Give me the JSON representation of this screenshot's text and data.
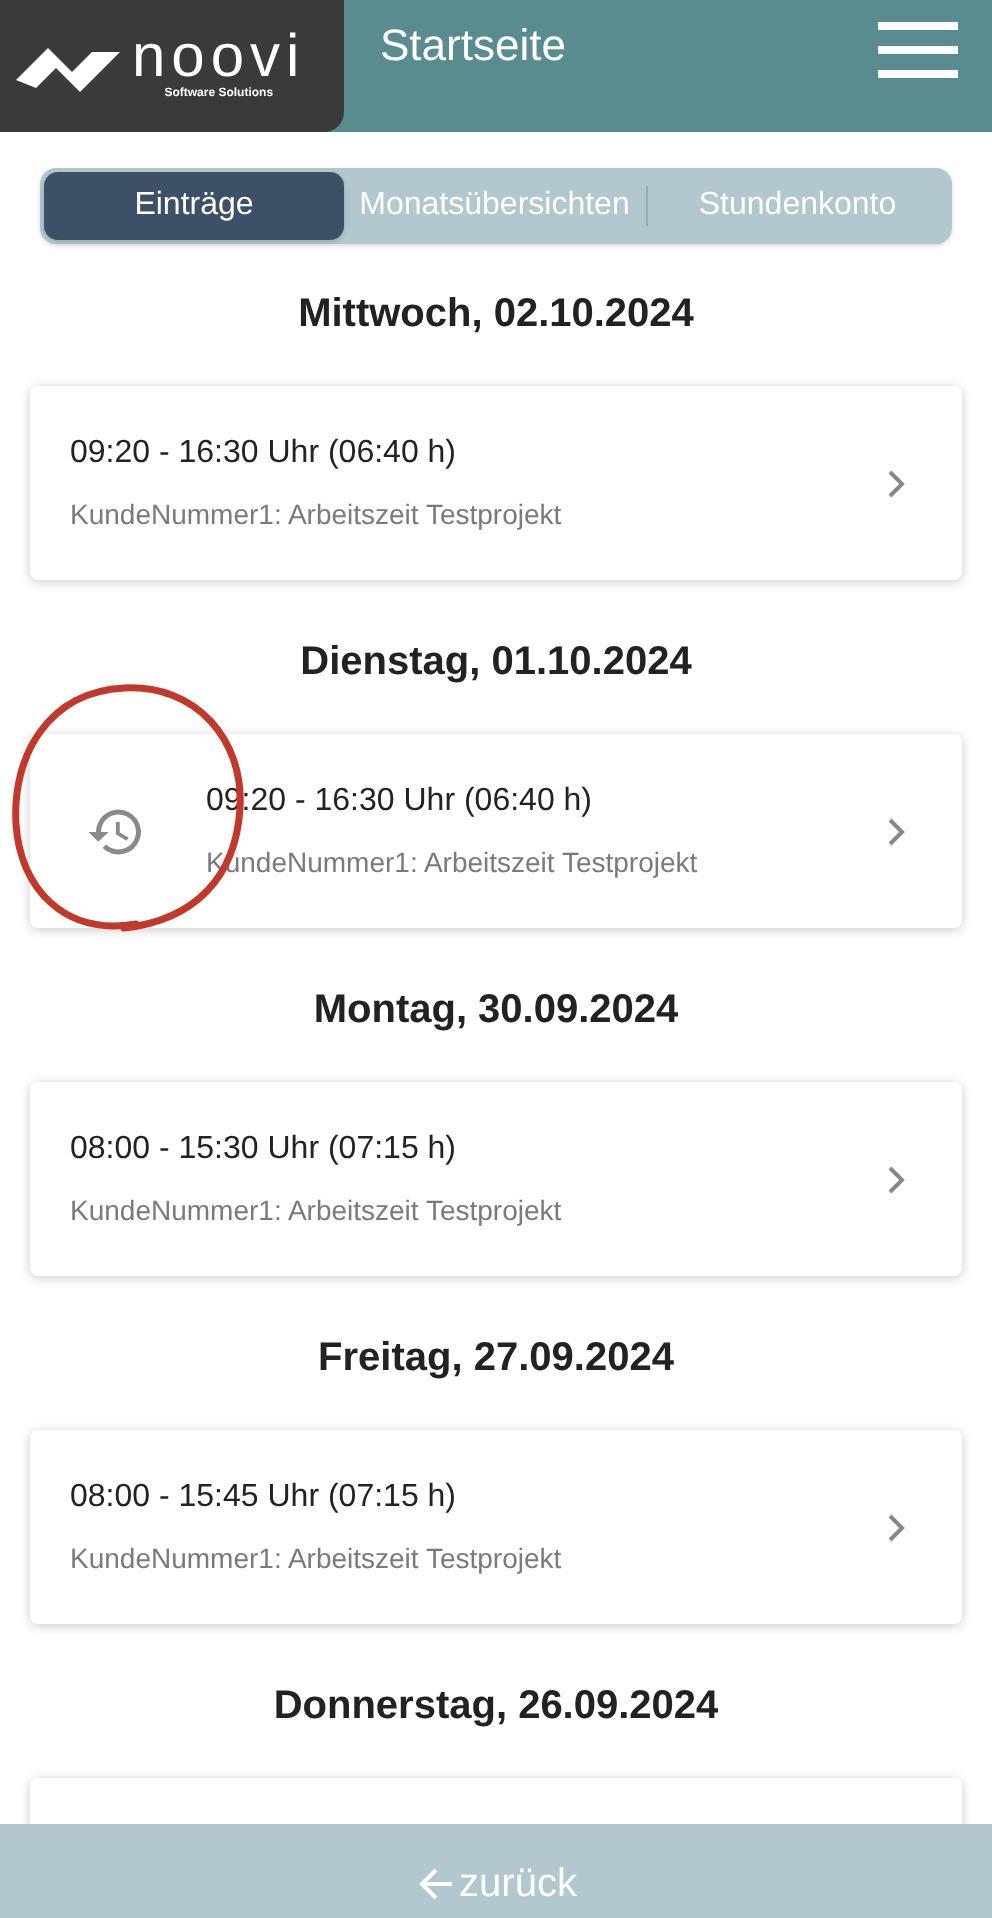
{
  "header": {
    "logo": {
      "name": "noovi",
      "tagline": "Software Solutions"
    },
    "title": "Startseite"
  },
  "tabs": [
    {
      "label": "Einträge",
      "selected": true
    },
    {
      "label": "Monatsübersichten",
      "selected": false
    },
    {
      "label": "Stundenkonto",
      "selected": false
    }
  ],
  "days": [
    {
      "date": "Mittwoch, 02.10.2024",
      "entries": [
        {
          "time": "09:20 - 16:30 Uhr (06:40 h)",
          "project": "KundeNummer1: Arbeitszeit Testprojekt",
          "history": false
        }
      ]
    },
    {
      "date": "Dienstag, 01.10.2024",
      "entries": [
        {
          "time": "09:20 - 16:30 Uhr (06:40 h)",
          "project": "KundeNummer1: Arbeitszeit Testprojekt",
          "history": true
        }
      ]
    },
    {
      "date": "Montag, 30.09.2024",
      "entries": [
        {
          "time": "08:00 - 15:30 Uhr (07:15 h)",
          "project": "KundeNummer1: Arbeitszeit Testprojekt",
          "history": false
        }
      ]
    },
    {
      "date": "Freitag, 27.09.2024",
      "entries": [
        {
          "time": "08:00 - 15:45 Uhr (07:15 h)",
          "project": "KundeNummer1: Arbeitszeit Testprojekt",
          "history": false
        }
      ]
    },
    {
      "date": "Donnerstag, 26.09.2024",
      "card_cut_off": true
    }
  ],
  "footer": {
    "back": "zurück"
  }
}
